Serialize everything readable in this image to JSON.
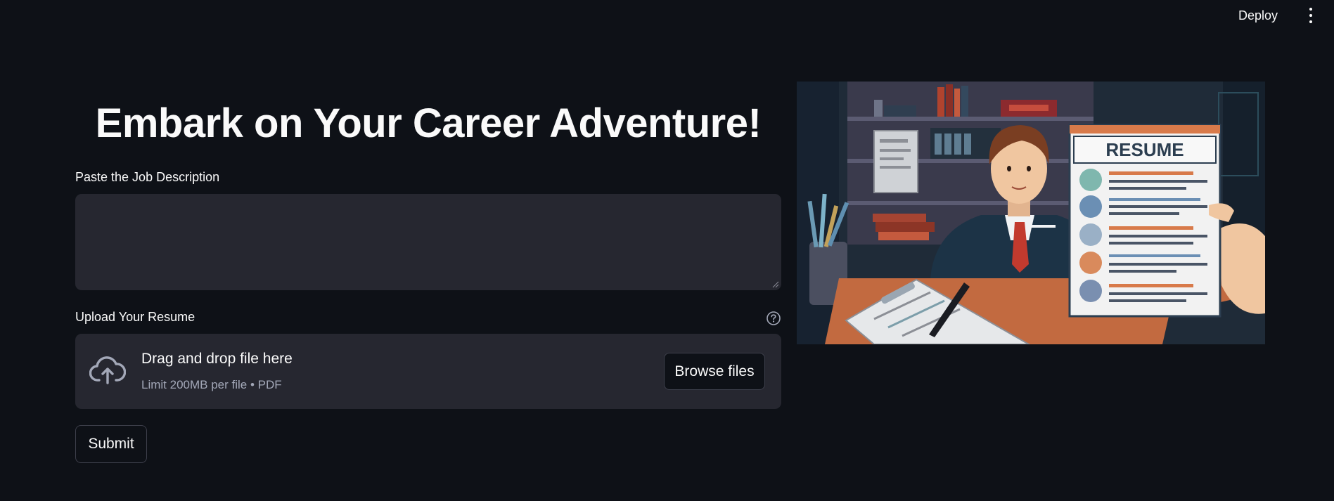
{
  "header": {
    "deploy_label": "Deploy",
    "menu_icon": "more-vertical-icon"
  },
  "main": {
    "title": "Embark on Your Career Adventure!",
    "job_description": {
      "label": "Paste the Job Description",
      "value": "",
      "placeholder": ""
    },
    "resume_upload": {
      "label": "Upload Your Resume",
      "help_icon": "question-circle-icon",
      "dropzone_icon": "cloud-upload-icon",
      "dropzone_text": "Drag and drop file here",
      "dropzone_limit": "Limit 200MB per file • PDF",
      "browse_label": "Browse files"
    },
    "submit_label": "Submit"
  },
  "illustration": {
    "resume_heading": "RESUME"
  },
  "colors": {
    "background": "#0e1117",
    "input_background": "#262730",
    "text": "#fafafa",
    "muted_text": "#a3a8b8",
    "button_border": "#3d3f4b"
  }
}
